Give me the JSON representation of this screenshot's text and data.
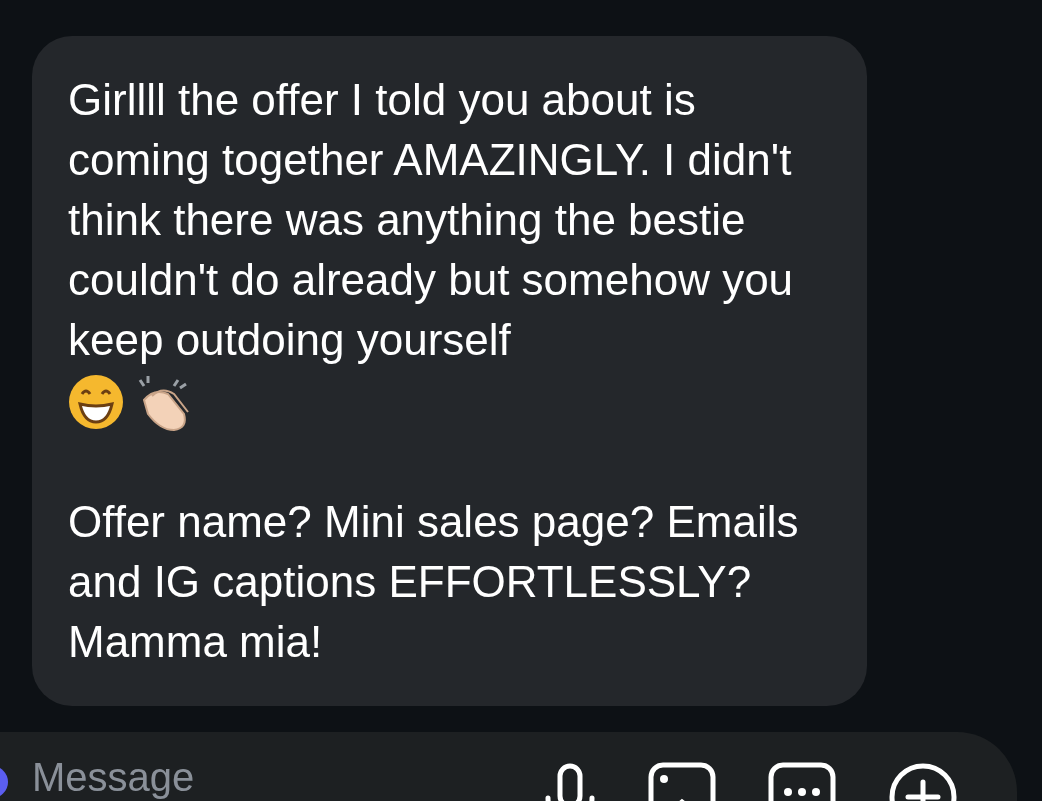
{
  "message": {
    "paragraphs": [
      "Girllll the offer I told you about is coming together AMAZINGLY. I didn't think there was anything the bestie couldn't do already but somehow you keep outdoing yourself",
      "Offer name? Mini sales page? Emails and IG captions EFFORTLESSLY? Mamma mia!"
    ]
  },
  "composer": {
    "placeholder": "Message"
  }
}
